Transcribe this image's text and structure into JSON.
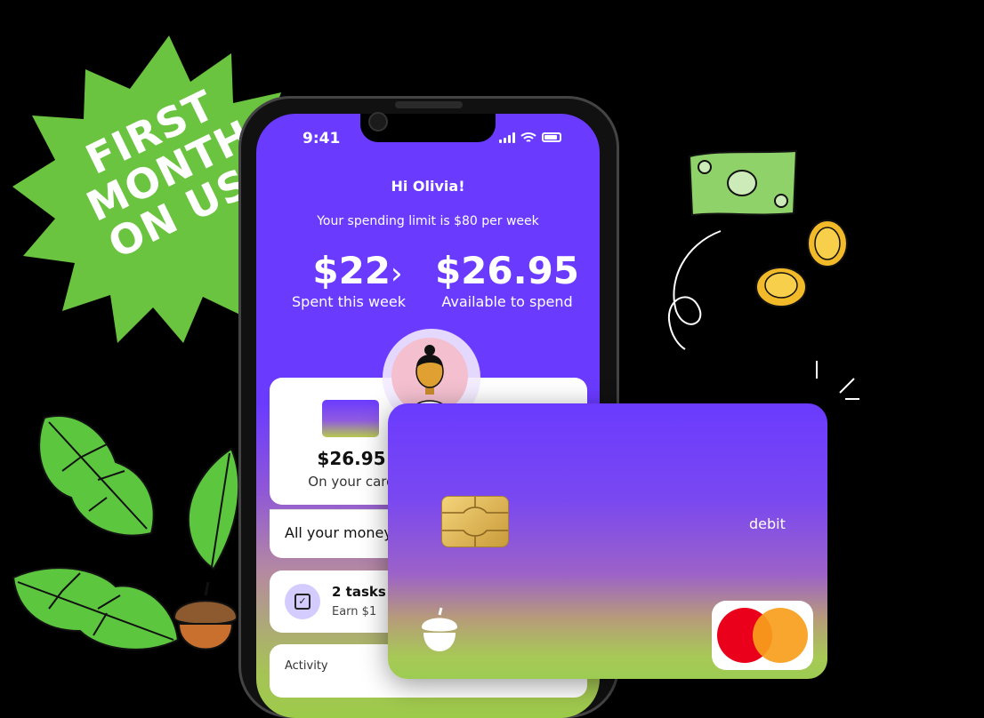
{
  "promo": {
    "line1": "FIRST",
    "line2": "MONTH",
    "line3": "ON US!"
  },
  "status_bar": {
    "time": "9:41"
  },
  "app": {
    "greeting": "Hi Olivia!",
    "spending_limit": "Your spending limit is $80 per week",
    "spent": {
      "amount": "$22",
      "chevron": "›",
      "label": "Spent this week"
    },
    "available": {
      "amount": "$26.95",
      "label": "Available to spend"
    },
    "card_summary": {
      "amount": "$26.95",
      "label": "On your card"
    },
    "all_money_label": "All your money",
    "tasks": {
      "title": "2 tasks t",
      "subtitle": "Earn $1"
    },
    "activity_label": "Activity"
  },
  "debit_card": {
    "label": "debit"
  },
  "colors": {
    "primary": "#6a3bff",
    "promo_green": "#6ac43f",
    "leaf_green": "#5cc63f",
    "coin_gold": "#f2b928"
  }
}
